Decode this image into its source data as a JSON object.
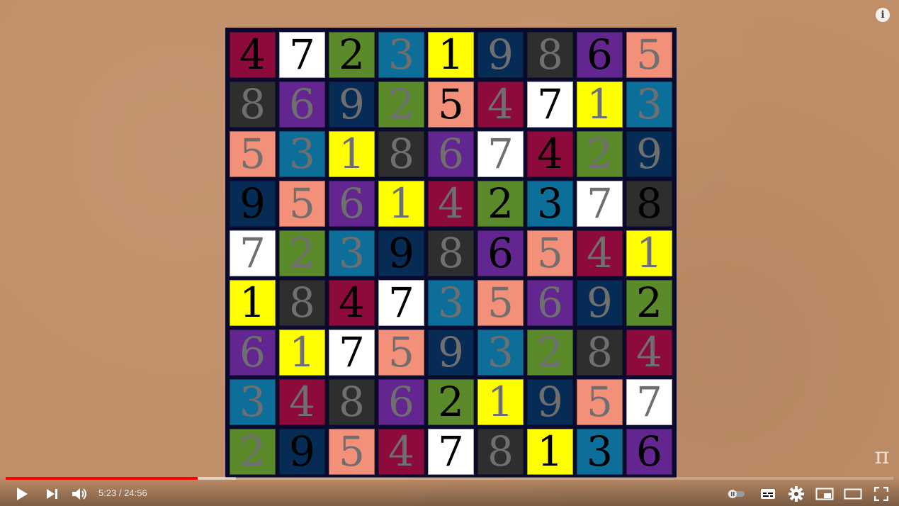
{
  "player": {
    "time_current": "5:23",
    "time_separator": " / ",
    "time_total": "24:56",
    "progress_fraction": 0.216,
    "buffered_fraction": 0.259,
    "watermark": "π",
    "info_glyph": "i",
    "icons": [
      "play-icon",
      "next-icon",
      "volume-icon",
      "autoplay-toggle-icon",
      "subtitles-icon",
      "settings-icon",
      "miniplayer-icon",
      "theater-mode-icon",
      "fullscreen-icon",
      "info-icon"
    ]
  },
  "colors": {
    "crimson": "#8c0a3c",
    "white": "#ffffff",
    "green": "#5a8a2a",
    "teal": "#0e6e9a",
    "yellow": "#ffff00",
    "navy": "#062b55",
    "charcoal": "#2e2e2e",
    "purple": "#63258f",
    "salmon": "#f2907a",
    "digit_black": "#000000",
    "digit_grey": "#6f6f6f",
    "board_border": "#0a0a2e",
    "progress_red": "#ff0000"
  },
  "sudoku": {
    "rows": [
      [
        {
          "d": "4",
          "bg": "crimson",
          "fg": "digit_black"
        },
        {
          "d": "7",
          "bg": "white",
          "fg": "digit_black"
        },
        {
          "d": "2",
          "bg": "green",
          "fg": "digit_black"
        },
        {
          "d": "3",
          "bg": "teal",
          "fg": "digit_grey"
        },
        {
          "d": "1",
          "bg": "yellow",
          "fg": "digit_black"
        },
        {
          "d": "9",
          "bg": "navy",
          "fg": "digit_grey"
        },
        {
          "d": "8",
          "bg": "charcoal",
          "fg": "digit_grey"
        },
        {
          "d": "6",
          "bg": "purple",
          "fg": "digit_black"
        },
        {
          "d": "5",
          "bg": "salmon",
          "fg": "digit_grey"
        }
      ],
      [
        {
          "d": "8",
          "bg": "charcoal",
          "fg": "digit_grey"
        },
        {
          "d": "6",
          "bg": "purple",
          "fg": "digit_grey"
        },
        {
          "d": "9",
          "bg": "navy",
          "fg": "digit_grey"
        },
        {
          "d": "2",
          "bg": "green",
          "fg": "digit_grey"
        },
        {
          "d": "5",
          "bg": "salmon",
          "fg": "digit_black"
        },
        {
          "d": "4",
          "bg": "crimson",
          "fg": "digit_grey"
        },
        {
          "d": "7",
          "bg": "white",
          "fg": "digit_black"
        },
        {
          "d": "1",
          "bg": "yellow",
          "fg": "digit_grey"
        },
        {
          "d": "3",
          "bg": "teal",
          "fg": "digit_grey"
        }
      ],
      [
        {
          "d": "5",
          "bg": "salmon",
          "fg": "digit_grey"
        },
        {
          "d": "3",
          "bg": "teal",
          "fg": "digit_grey"
        },
        {
          "d": "1",
          "bg": "yellow",
          "fg": "digit_grey"
        },
        {
          "d": "8",
          "bg": "charcoal",
          "fg": "digit_grey"
        },
        {
          "d": "6",
          "bg": "purple",
          "fg": "digit_grey"
        },
        {
          "d": "7",
          "bg": "white",
          "fg": "digit_grey"
        },
        {
          "d": "4",
          "bg": "crimson",
          "fg": "digit_black"
        },
        {
          "d": "2",
          "bg": "green",
          "fg": "digit_grey"
        },
        {
          "d": "9",
          "bg": "navy",
          "fg": "digit_grey"
        }
      ],
      [
        {
          "d": "9",
          "bg": "navy",
          "fg": "digit_black"
        },
        {
          "d": "5",
          "bg": "salmon",
          "fg": "digit_grey"
        },
        {
          "d": "6",
          "bg": "purple",
          "fg": "digit_grey"
        },
        {
          "d": "1",
          "bg": "yellow",
          "fg": "digit_grey"
        },
        {
          "d": "4",
          "bg": "crimson",
          "fg": "digit_grey"
        },
        {
          "d": "2",
          "bg": "green",
          "fg": "digit_black"
        },
        {
          "d": "3",
          "bg": "teal",
          "fg": "digit_black"
        },
        {
          "d": "7",
          "bg": "white",
          "fg": "digit_grey"
        },
        {
          "d": "8",
          "bg": "charcoal",
          "fg": "digit_black"
        }
      ],
      [
        {
          "d": "7",
          "bg": "white",
          "fg": "digit_grey"
        },
        {
          "d": "2",
          "bg": "green",
          "fg": "digit_grey"
        },
        {
          "d": "3",
          "bg": "teal",
          "fg": "digit_grey"
        },
        {
          "d": "9",
          "bg": "navy",
          "fg": "digit_black"
        },
        {
          "d": "8",
          "bg": "charcoal",
          "fg": "digit_grey"
        },
        {
          "d": "6",
          "bg": "purple",
          "fg": "digit_black"
        },
        {
          "d": "5",
          "bg": "salmon",
          "fg": "digit_grey"
        },
        {
          "d": "4",
          "bg": "crimson",
          "fg": "digit_grey"
        },
        {
          "d": "1",
          "bg": "yellow",
          "fg": "digit_grey"
        }
      ],
      [
        {
          "d": "1",
          "bg": "yellow",
          "fg": "digit_black"
        },
        {
          "d": "8",
          "bg": "charcoal",
          "fg": "digit_grey"
        },
        {
          "d": "4",
          "bg": "crimson",
          "fg": "digit_black"
        },
        {
          "d": "7",
          "bg": "white",
          "fg": "digit_black"
        },
        {
          "d": "3",
          "bg": "teal",
          "fg": "digit_grey"
        },
        {
          "d": "5",
          "bg": "salmon",
          "fg": "digit_grey"
        },
        {
          "d": "6",
          "bg": "purple",
          "fg": "digit_grey"
        },
        {
          "d": "9",
          "bg": "navy",
          "fg": "digit_grey"
        },
        {
          "d": "2",
          "bg": "green",
          "fg": "digit_black"
        }
      ],
      [
        {
          "d": "6",
          "bg": "purple",
          "fg": "digit_grey"
        },
        {
          "d": "1",
          "bg": "yellow",
          "fg": "digit_grey"
        },
        {
          "d": "7",
          "bg": "white",
          "fg": "digit_black"
        },
        {
          "d": "5",
          "bg": "salmon",
          "fg": "digit_grey"
        },
        {
          "d": "9",
          "bg": "navy",
          "fg": "digit_grey"
        },
        {
          "d": "3",
          "bg": "teal",
          "fg": "digit_grey"
        },
        {
          "d": "2",
          "bg": "green",
          "fg": "digit_grey"
        },
        {
          "d": "8",
          "bg": "charcoal",
          "fg": "digit_grey"
        },
        {
          "d": "4",
          "bg": "crimson",
          "fg": "digit_grey"
        }
      ],
      [
        {
          "d": "3",
          "bg": "teal",
          "fg": "digit_grey"
        },
        {
          "d": "4",
          "bg": "crimson",
          "fg": "digit_grey"
        },
        {
          "d": "8",
          "bg": "charcoal",
          "fg": "digit_grey"
        },
        {
          "d": "6",
          "bg": "purple",
          "fg": "digit_grey"
        },
        {
          "d": "2",
          "bg": "green",
          "fg": "digit_black"
        },
        {
          "d": "1",
          "bg": "yellow",
          "fg": "digit_grey"
        },
        {
          "d": "9",
          "bg": "navy",
          "fg": "digit_grey"
        },
        {
          "d": "5",
          "bg": "salmon",
          "fg": "digit_grey"
        },
        {
          "d": "7",
          "bg": "white",
          "fg": "digit_grey"
        }
      ],
      [
        {
          "d": "2",
          "bg": "green",
          "fg": "digit_grey"
        },
        {
          "d": "9",
          "bg": "navy",
          "fg": "digit_black"
        },
        {
          "d": "5",
          "bg": "salmon",
          "fg": "digit_grey"
        },
        {
          "d": "4",
          "bg": "crimson",
          "fg": "digit_grey"
        },
        {
          "d": "7",
          "bg": "white",
          "fg": "digit_black"
        },
        {
          "d": "8",
          "bg": "charcoal",
          "fg": "digit_grey"
        },
        {
          "d": "1",
          "bg": "yellow",
          "fg": "digit_black"
        },
        {
          "d": "3",
          "bg": "teal",
          "fg": "digit_black"
        },
        {
          "d": "6",
          "bg": "purple",
          "fg": "digit_black"
        }
      ]
    ]
  }
}
